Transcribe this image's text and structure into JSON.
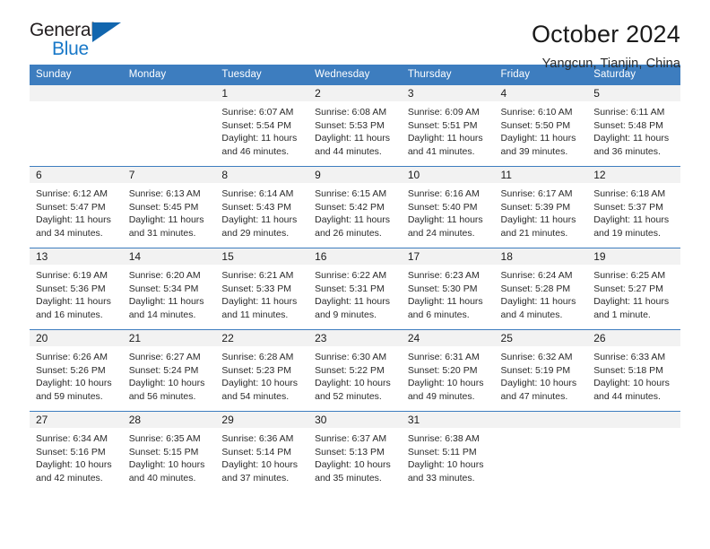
{
  "brand": {
    "name_top": "General",
    "name_bottom": "Blue",
    "accent_color": "#1266ae",
    "text_color": "#231f20"
  },
  "header": {
    "title": "October 2024",
    "subtitle": "Yangcun, Tianjin, China"
  },
  "theme": {
    "header_blue": "#3d7dbf",
    "daynum_bg": "#f2f2f2",
    "row_border": "#3d7dbf"
  },
  "weekdays": [
    "Sunday",
    "Monday",
    "Tuesday",
    "Wednesday",
    "Thursday",
    "Friday",
    "Saturday"
  ],
  "labels": {
    "sunrise": "Sunrise:",
    "sunset": "Sunset:",
    "daylight": "Daylight:"
  },
  "weeks": [
    [
      {
        "day": "",
        "sunrise": "",
        "sunset": "",
        "daylight_line1": "",
        "daylight_line2": ""
      },
      {
        "day": "",
        "sunrise": "",
        "sunset": "",
        "daylight_line1": "",
        "daylight_line2": ""
      },
      {
        "day": "1",
        "sunrise": "Sunrise: 6:07 AM",
        "sunset": "Sunset: 5:54 PM",
        "daylight_line1": "Daylight: 11 hours",
        "daylight_line2": "and 46 minutes."
      },
      {
        "day": "2",
        "sunrise": "Sunrise: 6:08 AM",
        "sunset": "Sunset: 5:53 PM",
        "daylight_line1": "Daylight: 11 hours",
        "daylight_line2": "and 44 minutes."
      },
      {
        "day": "3",
        "sunrise": "Sunrise: 6:09 AM",
        "sunset": "Sunset: 5:51 PM",
        "daylight_line1": "Daylight: 11 hours",
        "daylight_line2": "and 41 minutes."
      },
      {
        "day": "4",
        "sunrise": "Sunrise: 6:10 AM",
        "sunset": "Sunset: 5:50 PM",
        "daylight_line1": "Daylight: 11 hours",
        "daylight_line2": "and 39 minutes."
      },
      {
        "day": "5",
        "sunrise": "Sunrise: 6:11 AM",
        "sunset": "Sunset: 5:48 PM",
        "daylight_line1": "Daylight: 11 hours",
        "daylight_line2": "and 36 minutes."
      }
    ],
    [
      {
        "day": "6",
        "sunrise": "Sunrise: 6:12 AM",
        "sunset": "Sunset: 5:47 PM",
        "daylight_line1": "Daylight: 11 hours",
        "daylight_line2": "and 34 minutes."
      },
      {
        "day": "7",
        "sunrise": "Sunrise: 6:13 AM",
        "sunset": "Sunset: 5:45 PM",
        "daylight_line1": "Daylight: 11 hours",
        "daylight_line2": "and 31 minutes."
      },
      {
        "day": "8",
        "sunrise": "Sunrise: 6:14 AM",
        "sunset": "Sunset: 5:43 PM",
        "daylight_line1": "Daylight: 11 hours",
        "daylight_line2": "and 29 minutes."
      },
      {
        "day": "9",
        "sunrise": "Sunrise: 6:15 AM",
        "sunset": "Sunset: 5:42 PM",
        "daylight_line1": "Daylight: 11 hours",
        "daylight_line2": "and 26 minutes."
      },
      {
        "day": "10",
        "sunrise": "Sunrise: 6:16 AM",
        "sunset": "Sunset: 5:40 PM",
        "daylight_line1": "Daylight: 11 hours",
        "daylight_line2": "and 24 minutes."
      },
      {
        "day": "11",
        "sunrise": "Sunrise: 6:17 AM",
        "sunset": "Sunset: 5:39 PM",
        "daylight_line1": "Daylight: 11 hours",
        "daylight_line2": "and 21 minutes."
      },
      {
        "day": "12",
        "sunrise": "Sunrise: 6:18 AM",
        "sunset": "Sunset: 5:37 PM",
        "daylight_line1": "Daylight: 11 hours",
        "daylight_line2": "and 19 minutes."
      }
    ],
    [
      {
        "day": "13",
        "sunrise": "Sunrise: 6:19 AM",
        "sunset": "Sunset: 5:36 PM",
        "daylight_line1": "Daylight: 11 hours",
        "daylight_line2": "and 16 minutes."
      },
      {
        "day": "14",
        "sunrise": "Sunrise: 6:20 AM",
        "sunset": "Sunset: 5:34 PM",
        "daylight_line1": "Daylight: 11 hours",
        "daylight_line2": "and 14 minutes."
      },
      {
        "day": "15",
        "sunrise": "Sunrise: 6:21 AM",
        "sunset": "Sunset: 5:33 PM",
        "daylight_line1": "Daylight: 11 hours",
        "daylight_line2": "and 11 minutes."
      },
      {
        "day": "16",
        "sunrise": "Sunrise: 6:22 AM",
        "sunset": "Sunset: 5:31 PM",
        "daylight_line1": "Daylight: 11 hours",
        "daylight_line2": "and 9 minutes."
      },
      {
        "day": "17",
        "sunrise": "Sunrise: 6:23 AM",
        "sunset": "Sunset: 5:30 PM",
        "daylight_line1": "Daylight: 11 hours",
        "daylight_line2": "and 6 minutes."
      },
      {
        "day": "18",
        "sunrise": "Sunrise: 6:24 AM",
        "sunset": "Sunset: 5:28 PM",
        "daylight_line1": "Daylight: 11 hours",
        "daylight_line2": "and 4 minutes."
      },
      {
        "day": "19",
        "sunrise": "Sunrise: 6:25 AM",
        "sunset": "Sunset: 5:27 PM",
        "daylight_line1": "Daylight: 11 hours",
        "daylight_line2": "and 1 minute."
      }
    ],
    [
      {
        "day": "20",
        "sunrise": "Sunrise: 6:26 AM",
        "sunset": "Sunset: 5:26 PM",
        "daylight_line1": "Daylight: 10 hours",
        "daylight_line2": "and 59 minutes."
      },
      {
        "day": "21",
        "sunrise": "Sunrise: 6:27 AM",
        "sunset": "Sunset: 5:24 PM",
        "daylight_line1": "Daylight: 10 hours",
        "daylight_line2": "and 56 minutes."
      },
      {
        "day": "22",
        "sunrise": "Sunrise: 6:28 AM",
        "sunset": "Sunset: 5:23 PM",
        "daylight_line1": "Daylight: 10 hours",
        "daylight_line2": "and 54 minutes."
      },
      {
        "day": "23",
        "sunrise": "Sunrise: 6:30 AM",
        "sunset": "Sunset: 5:22 PM",
        "daylight_line1": "Daylight: 10 hours",
        "daylight_line2": "and 52 minutes."
      },
      {
        "day": "24",
        "sunrise": "Sunrise: 6:31 AM",
        "sunset": "Sunset: 5:20 PM",
        "daylight_line1": "Daylight: 10 hours",
        "daylight_line2": "and 49 minutes."
      },
      {
        "day": "25",
        "sunrise": "Sunrise: 6:32 AM",
        "sunset": "Sunset: 5:19 PM",
        "daylight_line1": "Daylight: 10 hours",
        "daylight_line2": "and 47 minutes."
      },
      {
        "day": "26",
        "sunrise": "Sunrise: 6:33 AM",
        "sunset": "Sunset: 5:18 PM",
        "daylight_line1": "Daylight: 10 hours",
        "daylight_line2": "and 44 minutes."
      }
    ],
    [
      {
        "day": "27",
        "sunrise": "Sunrise: 6:34 AM",
        "sunset": "Sunset: 5:16 PM",
        "daylight_line1": "Daylight: 10 hours",
        "daylight_line2": "and 42 minutes."
      },
      {
        "day": "28",
        "sunrise": "Sunrise: 6:35 AM",
        "sunset": "Sunset: 5:15 PM",
        "daylight_line1": "Daylight: 10 hours",
        "daylight_line2": "and 40 minutes."
      },
      {
        "day": "29",
        "sunrise": "Sunrise: 6:36 AM",
        "sunset": "Sunset: 5:14 PM",
        "daylight_line1": "Daylight: 10 hours",
        "daylight_line2": "and 37 minutes."
      },
      {
        "day": "30",
        "sunrise": "Sunrise: 6:37 AM",
        "sunset": "Sunset: 5:13 PM",
        "daylight_line1": "Daylight: 10 hours",
        "daylight_line2": "and 35 minutes."
      },
      {
        "day": "31",
        "sunrise": "Sunrise: 6:38 AM",
        "sunset": "Sunset: 5:11 PM",
        "daylight_line1": "Daylight: 10 hours",
        "daylight_line2": "and 33 minutes."
      },
      {
        "day": "",
        "sunrise": "",
        "sunset": "",
        "daylight_line1": "",
        "daylight_line2": ""
      },
      {
        "day": "",
        "sunrise": "",
        "sunset": "",
        "daylight_line1": "",
        "daylight_line2": ""
      }
    ]
  ]
}
